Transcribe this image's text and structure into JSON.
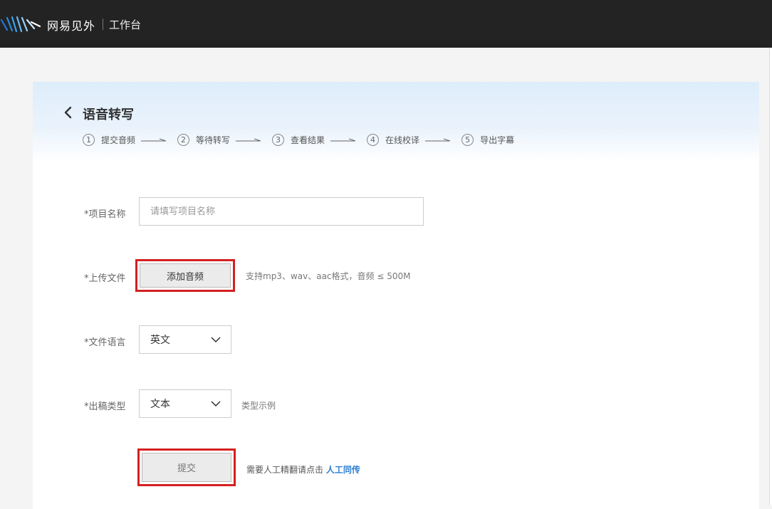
{
  "header": {
    "brand": "网易见外",
    "workspace": "工作台"
  },
  "page": {
    "title": "语音转写",
    "steps": [
      {
        "num": "1",
        "label": "提交音频"
      },
      {
        "num": "2",
        "label": "等待转写"
      },
      {
        "num": "3",
        "label": "查看结果"
      },
      {
        "num": "4",
        "label": "在线校译"
      },
      {
        "num": "5",
        "label": "导出字幕"
      }
    ]
  },
  "form": {
    "project_name": {
      "label": "*项目名称",
      "value": "",
      "placeholder": "请填写项目名称"
    },
    "upload": {
      "label": "*上传文件",
      "button": "添加音频",
      "hint": "支持mp3、wav、aac格式，音频 ≤ 500M"
    },
    "language": {
      "label": "*文件语言",
      "selected": "英文"
    },
    "output_type": {
      "label": "*出稿类型",
      "selected": "文本",
      "hint": "类型示例"
    },
    "submit": {
      "button": "提交",
      "hint": "需要人工精翻请点击",
      "link": "人工同传"
    }
  },
  "colors": {
    "topbar": "#232323",
    "highlight": "#d42020",
    "link": "#2b7fd1"
  }
}
